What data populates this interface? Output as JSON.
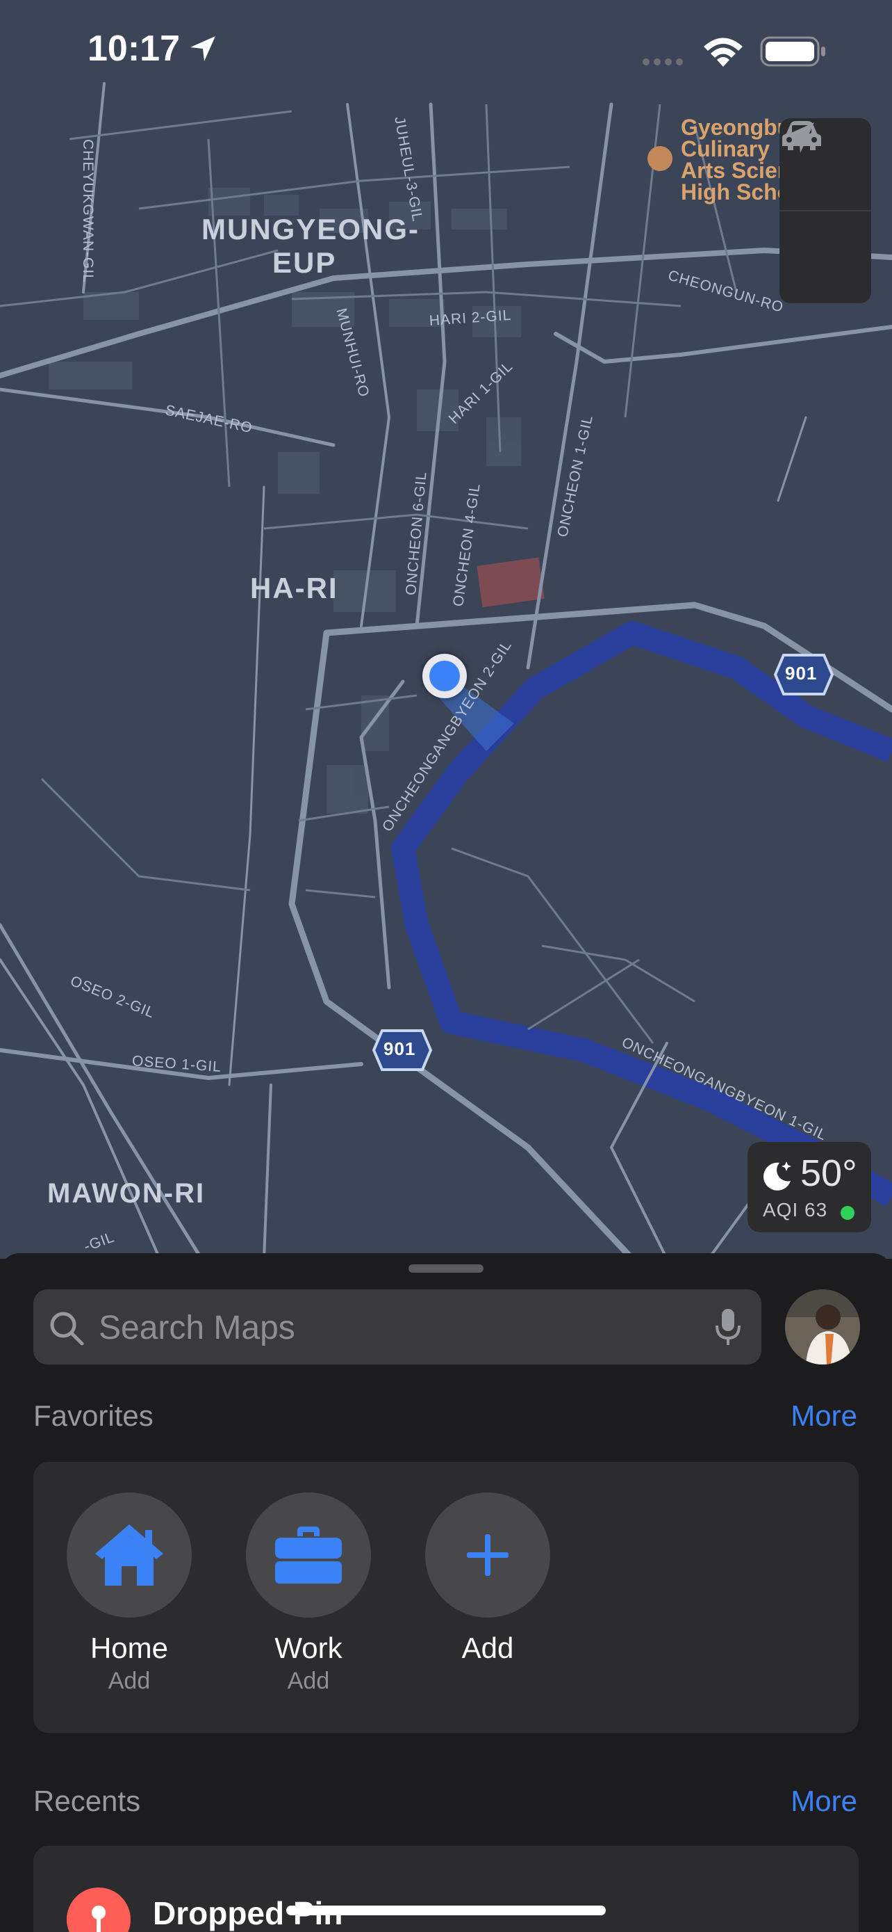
{
  "status_bar": {
    "time": "10:17"
  },
  "map": {
    "places": {
      "mungyeong": "MUNGYEONG-",
      "mungyeong2": "EUP",
      "hari": "HA-RI",
      "mawonri": "MAWON-RI",
      "poi_line1": "Gyeongbu",
      "poi_line2": "Culinary",
      "poi_line3": "Arts Scien",
      "poi_line4": "High Scho"
    },
    "roads": {
      "cheyukgwan": "CHEYUKGWAN-GIL",
      "juheul": "JUHEUL-3-GIL",
      "cheongun": "CHEONGUN-RO",
      "hari2": "HARI 2-GIL",
      "hari1": "HARI 1-GIL",
      "munhui": "MUNHUI-RO",
      "saejae": "SAEJAE-RO",
      "oncheon6": "ONCHEON 6-GIL",
      "oncheon4": "ONCHEON 4-GIL",
      "oncheon1": "ONCHEON 1-GIL",
      "oncheongang2": "ONCHEONGANGBYEON 2-GIL",
      "oncheongang1": "ONCHEONGANGBYEON 1-GIL",
      "oseo2": "OSEO 2-GIL",
      "oseo1": "OSEO 1-GIL",
      "gil": "-GIL",
      "route1": "901",
      "route2": "901"
    },
    "weather": {
      "temp": "50°",
      "aqi": "AQI 63",
      "aqi_color": "#30d158"
    }
  },
  "sheet": {
    "search_placeholder": "Search Maps",
    "favorites_title": "Favorites",
    "favorites_more": "More",
    "favorites": [
      {
        "label": "Home",
        "sub": "Add",
        "icon": "house-icon"
      },
      {
        "label": "Work",
        "sub": "Add",
        "icon": "briefcase-icon"
      },
      {
        "label": "Add",
        "sub": "",
        "icon": "plus-icon"
      }
    ],
    "recents_title": "Recents",
    "recents_more": "More",
    "recents": [
      {
        "title": "Dropped Pin",
        "icon": "pin-icon"
      }
    ]
  },
  "colors": {
    "accent": "#3b82f6",
    "river": "#2a3f9c",
    "map_bg": "#3b4557"
  }
}
